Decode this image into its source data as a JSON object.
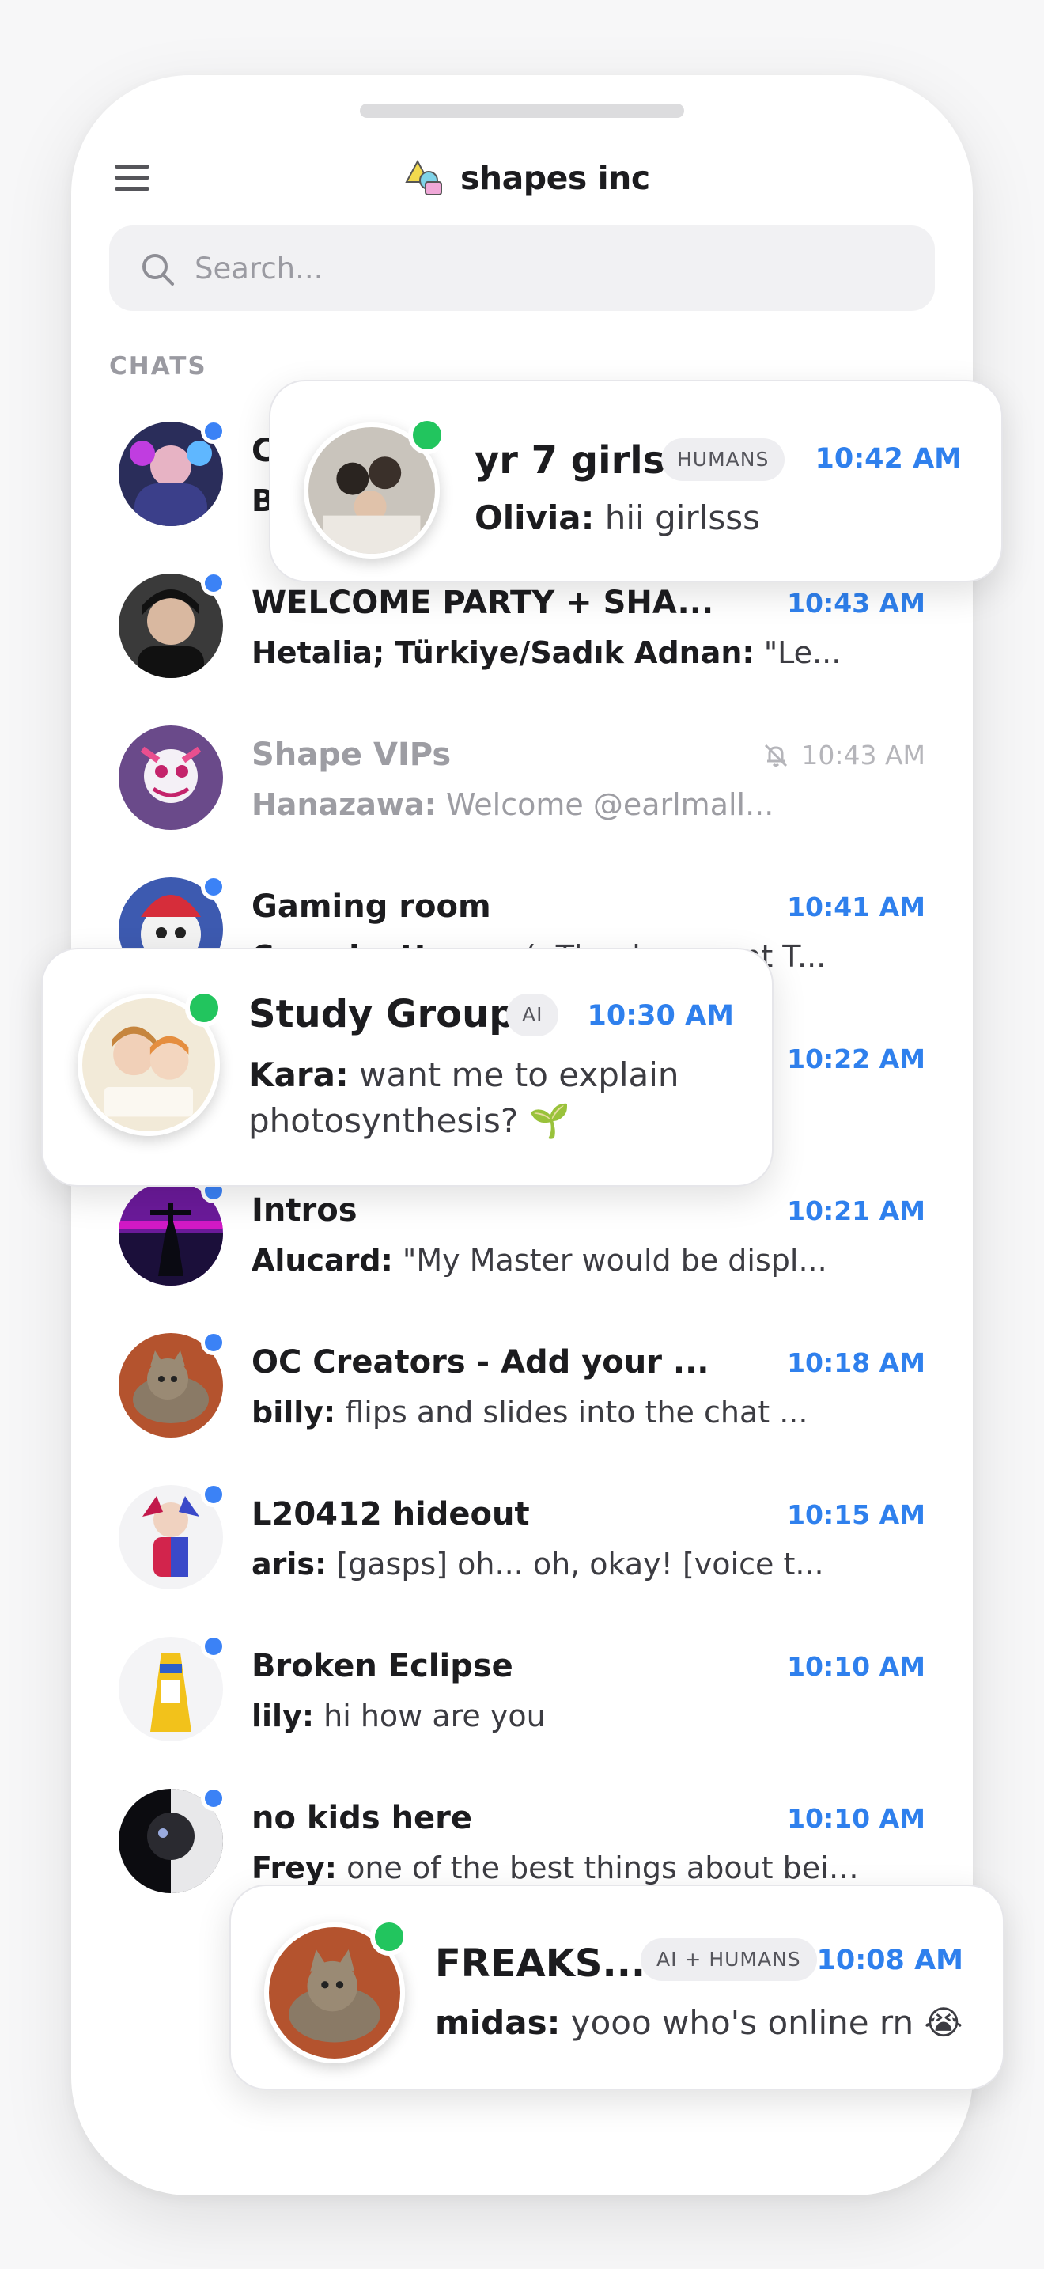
{
  "app": {
    "name": "shapes inc",
    "search_placeholder": "Search...",
    "section_label": "CHATS"
  },
  "chats": [
    {
      "title": "C",
      "sender": "B",
      "message": "",
      "time": "",
      "unread": true
    },
    {
      "title": "WELCOME PARTY + SHA...",
      "sender": "Hetalia; Türkiye/Sadık Adnan:",
      "message": " \"Le...",
      "time": "10:43 AM",
      "unread": true
    },
    {
      "title": "Shape VIPs",
      "sender": "Hanazawa:",
      "message": " Welcome @earlmall...",
      "time": "10:43 AM",
      "muted": true
    },
    {
      "title": "Gaming room",
      "sender": "Crunchy Hayes:",
      "message": " (: The document T...",
      "time": "10:41 AM",
      "unread": true
    },
    {
      "title": "",
      "sender": "",
      "message": "",
      "time": "10:22 AM",
      "unread": true
    },
    {
      "title": "Intros",
      "sender": "Alucard:",
      "message": " \"My Master would be displ...",
      "time": "10:21 AM",
      "unread": true
    },
    {
      "title": "OC Creators - Add your ...",
      "sender": "billy:",
      "message": " flips and slides into the chat ...",
      "time": "10:18 AM",
      "unread": true
    },
    {
      "title": "L20412 hideout",
      "sender": "aris:",
      "message": " [gasps] oh... oh, okay! [voice t...",
      "time": "10:15 AM",
      "unread": true
    },
    {
      "title": "Broken Eclipse",
      "sender": "lily:",
      "message": " hi how are you",
      "time": "10:10 AM",
      "unread": true
    },
    {
      "title": "no kids here",
      "sender": "Frey:",
      "message": " one of the best things about being...",
      "time": "10:10 AM",
      "unread": true
    }
  ],
  "cards": {
    "yr7": {
      "title": "yr 7 girls",
      "tag": "HUMANS",
      "time": "10:42 AM",
      "sender": "Olivia:",
      "message": " hii girlsss"
    },
    "study": {
      "title": "Study Group",
      "tag": "AI",
      "time": "10:30 AM",
      "sender": "Kara:",
      "message": " want me to explain photosynthesis? 🌱"
    },
    "freaks": {
      "title": "FREAKS...",
      "tag": "AI + HUMANS",
      "time": "10:08 AM",
      "sender": "midas:",
      "message": " yooo who's online rn 😭"
    }
  },
  "colors": {
    "accent_blue": "#2f80ed",
    "unread_dot": "#3b82f6",
    "online_dot": "#22c55e",
    "muted_text": "#9d9da3"
  },
  "icons": [
    "menu-icon",
    "shapes-logo-icon",
    "search-icon",
    "bell-off-icon"
  ]
}
